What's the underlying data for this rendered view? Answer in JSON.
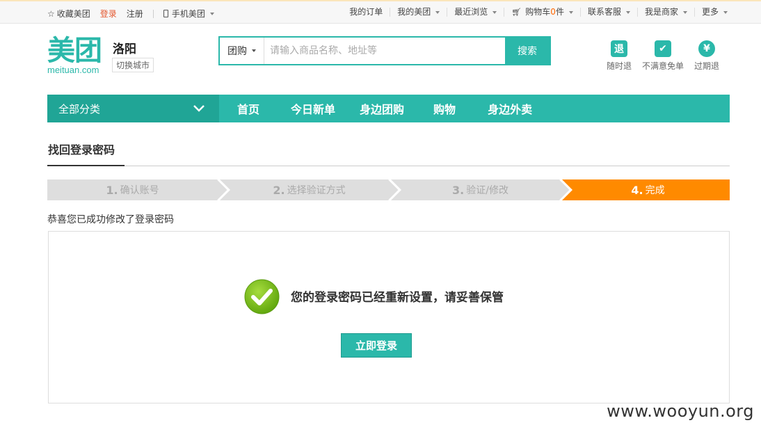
{
  "topbar": {
    "favorite": "收藏美团",
    "login": "登录",
    "register": "注册",
    "mobile": "手机美团",
    "right_items": [
      "我的订单",
      "我的美团",
      "最近浏览",
      "购物车",
      "联系客服",
      "我是商家",
      "更多"
    ],
    "cart_count": "0",
    "cart_unit": "件"
  },
  "header": {
    "logo_cn": "美团",
    "logo_en": "meituan.com",
    "city": "洛阳",
    "switch_city": "切换城市",
    "search_category": "团购",
    "search_placeholder": "请输入商品名称、地址等",
    "search_button": "搜索",
    "promises": [
      {
        "icon": "退",
        "label": "随时退"
      },
      {
        "icon": "✔",
        "label": "不满意免单"
      },
      {
        "icon": "¥",
        "label": "过期退"
      }
    ]
  },
  "nav": {
    "all_categories": "全部分类",
    "links": [
      "首页",
      "今日新单",
      "身边团购",
      "购物",
      "身边外卖"
    ]
  },
  "page": {
    "title": "找回登录密码",
    "steps": [
      {
        "num": "1.",
        "label": "确认账号"
      },
      {
        "num": "2.",
        "label": "选择验证方式"
      },
      {
        "num": "3.",
        "label": "验证/修改"
      },
      {
        "num": "4.",
        "label": "完成"
      }
    ],
    "active_step": 4,
    "message": "恭喜您已成功修改了登录密码",
    "success_text": "您的登录密码已经重新设置，请妥善保管",
    "login_button": "立即登录"
  },
  "watermark": "www.wooyun.org",
  "colors": {
    "accent": "#2bb8aa",
    "step_active": "#ff8a00",
    "step_inactive": "#dedede",
    "success_green": "#79c020"
  }
}
